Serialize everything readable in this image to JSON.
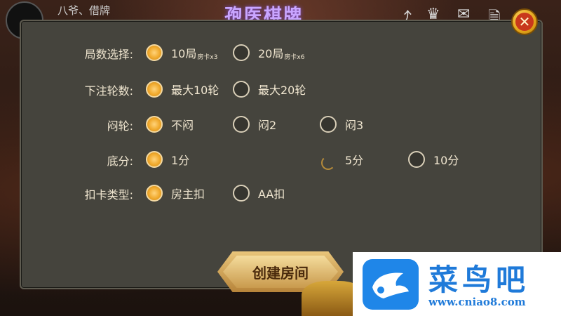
{
  "topbar": {
    "player_name": "八爷、借牌",
    "logo_text": "孢医棋牌",
    "icons": [
      "share-icon",
      "crown-icon",
      "mail-icon",
      "document-icon"
    ]
  },
  "dialog": {
    "rows": [
      {
        "label": "局数选择:",
        "options": [
          {
            "text": "10局",
            "sub": "房卡x3",
            "selected": true
          },
          {
            "text": "20局",
            "sub": "房卡x6",
            "selected": false
          }
        ]
      },
      {
        "label": "下注轮数:",
        "options": [
          {
            "text": "最大10轮",
            "selected": true
          },
          {
            "text": "最大20轮",
            "selected": false
          }
        ]
      },
      {
        "label": "闷轮:",
        "options": [
          {
            "text": "不闷",
            "selected": true
          },
          {
            "text": "闷2",
            "selected": false
          },
          {
            "text": "闷3",
            "selected": false
          }
        ]
      },
      {
        "label": "底分:",
        "options": [
          {
            "text": "1分",
            "selected": true
          },
          {
            "text": "5分",
            "selected": false
          },
          {
            "text": "10分",
            "selected": false
          }
        ]
      },
      {
        "label": "扣卡类型:",
        "options": [
          {
            "text": "房主扣",
            "selected": true
          },
          {
            "text": "AA扣",
            "selected": false
          }
        ]
      }
    ],
    "create_button": "创建房间"
  },
  "watermark": {
    "title": "菜鸟吧",
    "url": "www.cniao8.com"
  },
  "colors": {
    "panel_bg": "#45443d",
    "selected_radio": "#f0a92c",
    "text": "#f0e6d0",
    "watermark_blue": "#1f7ad9"
  }
}
